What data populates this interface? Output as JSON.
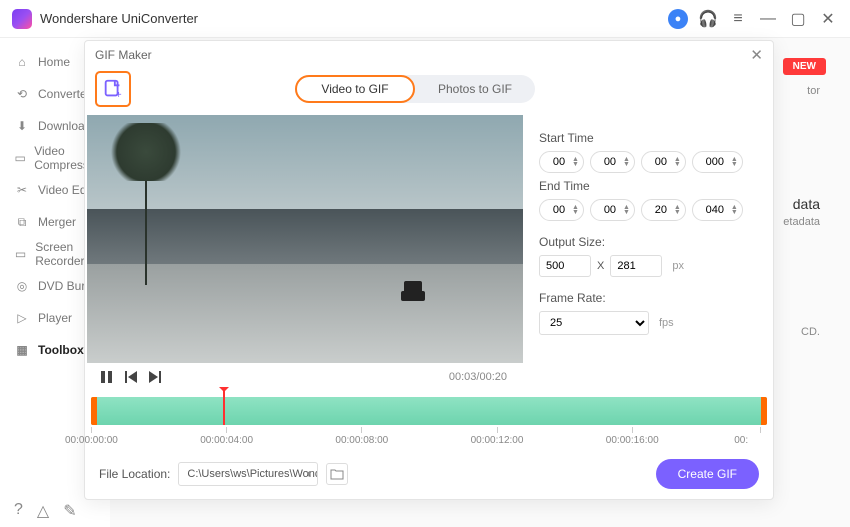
{
  "app": {
    "title": "Wondershare UniConverter"
  },
  "window_controls": {
    "min": "—",
    "max": "▢",
    "close": "✕"
  },
  "titlebar_icons": {
    "user": "●",
    "support": "🎧",
    "menu": "≡"
  },
  "sidebar": {
    "items": [
      {
        "label": "Home",
        "icon": "⌂"
      },
      {
        "label": "Converter",
        "icon": "⟲"
      },
      {
        "label": "Downloader",
        "icon": "⬇"
      },
      {
        "label": "Video Compressor",
        "icon": "▭"
      },
      {
        "label": "Video Editor",
        "icon": "✂"
      },
      {
        "label": "Merger",
        "icon": "⧉"
      },
      {
        "label": "Screen Recorder",
        "icon": "▭"
      },
      {
        "label": "DVD Burner",
        "icon": "◎"
      },
      {
        "label": "Player",
        "icon": "▷"
      },
      {
        "label": "Toolbox",
        "icon": "▦"
      }
    ],
    "bottom": {
      "help": "?",
      "bell": "△",
      "feedback": "✎"
    }
  },
  "bg": {
    "badge_new": "NEW",
    "txt_tor": "tor",
    "txt_data": "data",
    "txt_tadata": "etadata",
    "txt_cd": "CD."
  },
  "modal": {
    "title": "GIF Maker",
    "tabs": {
      "video": "Video to GIF",
      "photos": "Photos to GIF"
    },
    "start_label": "Start Time",
    "end_label": "End Time",
    "start": {
      "h": "00",
      "m": "00",
      "s": "00",
      "ms": "000"
    },
    "end": {
      "h": "00",
      "m": "00",
      "s": "20",
      "ms": "040"
    },
    "output_size_label": "Output Size:",
    "output_w": "500",
    "output_x": "X",
    "output_h": "281",
    "output_unit": "px",
    "frame_rate_label": "Frame Rate:",
    "frame_rate": "25",
    "fr_unit": "fps",
    "timecode": "00:03/00:20",
    "ruler": [
      "00:00:00:00",
      "00:00:04:00",
      "00:00:08:00",
      "00:00:12:00",
      "00:00:16:00",
      "00:"
    ],
    "playhead_pct": 19.5,
    "file_loc_label": "File Location:",
    "file_loc_value": "C:\\Users\\ws\\Pictures\\Wonders",
    "create_btn": "Create GIF"
  }
}
